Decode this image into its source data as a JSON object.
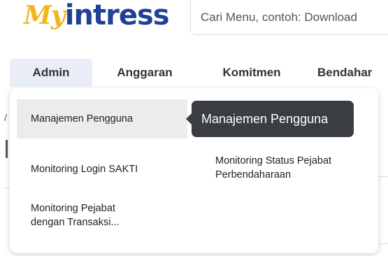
{
  "header": {
    "logo_my": "My",
    "logo_intress": "intress",
    "search_placeholder": "Cari Menu, contoh: Download"
  },
  "nav": {
    "items": [
      {
        "label": "Admin",
        "active": true
      },
      {
        "label": "Anggaran",
        "active": false
      },
      {
        "label": "Komitmen",
        "active": false
      },
      {
        "label": "Bendahar",
        "active": false
      }
    ]
  },
  "dropdown": {
    "items": [
      {
        "label": "Manajemen Pengguna",
        "highlighted": true
      },
      {
        "label": "Monitoring Login SAKTI",
        "highlighted": false
      },
      {
        "label": "Monitoring Status Pejabat Perbendaharaan",
        "highlighted": false
      },
      {
        "label": "Monitoring Pejabat dengan Transaksi...",
        "highlighted": false
      }
    ]
  },
  "tooltip": {
    "text": "Manajemen Pengguna"
  },
  "colors": {
    "logo_yellow": "#f2b51c",
    "logo_blue": "#1f4196",
    "active_tab_bg": "#e9eef6",
    "tooltip_bg": "#3a3d42"
  }
}
